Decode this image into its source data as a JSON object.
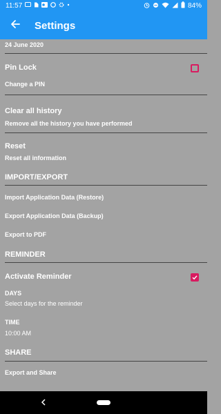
{
  "status_bar": {
    "time": "11:57",
    "battery": "84%"
  },
  "header": {
    "title": "Settings"
  },
  "general": {
    "date_value": "24 June 2020",
    "pin_lock_label": "Pin Lock",
    "change_pin_label": "Change a PIN",
    "clear_history_title": "Clear all history",
    "clear_history_sub": "Remove all the history you have performed",
    "reset_title": "Reset",
    "reset_sub": "Reset all information"
  },
  "import_export": {
    "heading": "IMPORT/EXPORT",
    "restore_label": "Import Application Data (Restore)",
    "backup_label": "Export Application Data (Backup)",
    "pdf_label": "Export to PDF"
  },
  "reminder": {
    "heading": "REMINDER",
    "activate_label": "Activate Reminder",
    "activate_checked": true,
    "days_label": "DAYS",
    "days_sub": "Select days for the reminder",
    "time_label": "TIME",
    "time_value": "10:00 AM"
  },
  "share": {
    "heading": "SHARE",
    "export_share_label": "Export and Share"
  },
  "colors": {
    "primary": "#2196f3",
    "background": "#a3a3a3",
    "accent": "#d81b60"
  },
  "icons": {
    "back": "arrow-left-icon",
    "nav_back": "chevron-left-icon",
    "nav_home": "home-pill-icon"
  }
}
